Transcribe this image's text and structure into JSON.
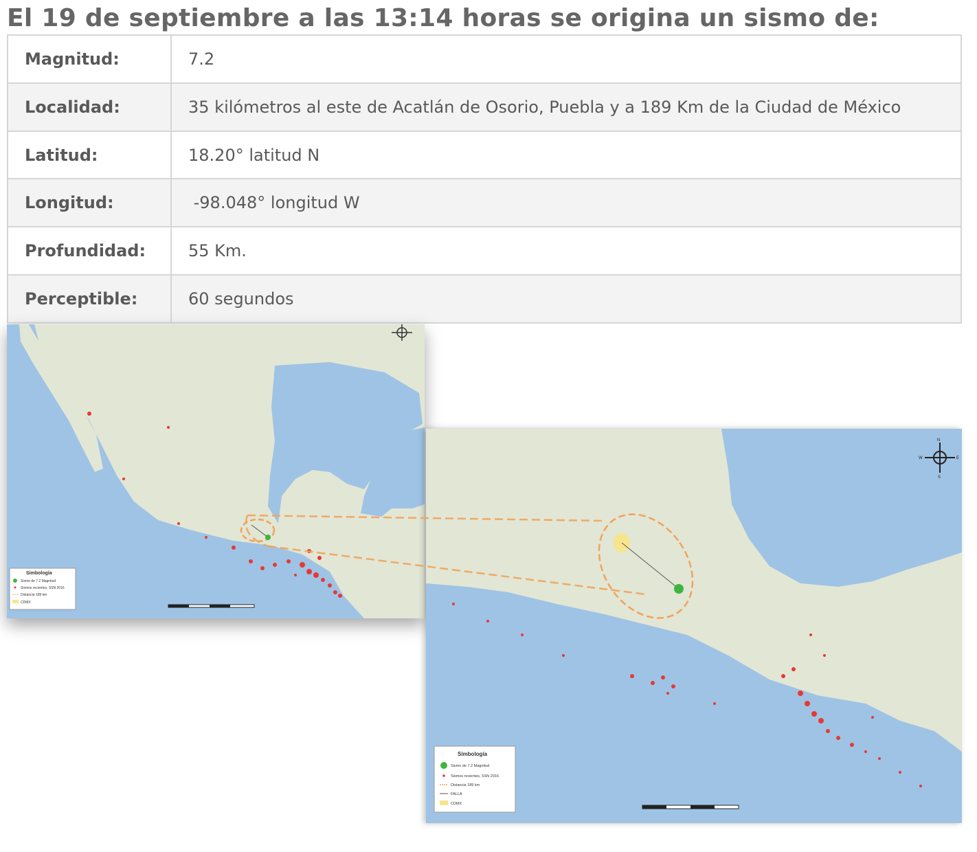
{
  "heading": "El 19 de septiembre a las 13:14 horas se origina un sismo de:",
  "rows": [
    {
      "label": "Magnitud:",
      "value": "7.2"
    },
    {
      "label": "Localidad:",
      "value": "35 kilómetros al este de Acatlán de Osorio, Puebla y a 189 Km de la Ciudad de México"
    },
    {
      "label": "Latitud:",
      "value": "18.20° latitud N"
    },
    {
      "label": "Longitud:",
      "value": " -98.048° longitud W"
    },
    {
      "label": "Profundidad:",
      "value": "55 Km."
    },
    {
      "label": "Perceptible:",
      "value": "60 segundos"
    }
  ],
  "maps": {
    "legend_title": "Simbología",
    "legend_small": [
      "Sismo de 7.2 Magnitud",
      "Sismos recientes, SSN 2016",
      "Distancia 189 km",
      "CDMX"
    ],
    "legend_large": [
      "Sismo de 7.2 Magnitud",
      "Sismos recientes, SSN 2016",
      "Distancia 189 km",
      "FALLA",
      "CDMX"
    ],
    "compass": {
      "n": "N",
      "s": "S",
      "e": "E",
      "w": "W"
    },
    "colors": {
      "ocean": "#9fc3e4",
      "land": "#e2e6d5",
      "epicenter": "#3fb53f",
      "recent_quakes": "#e53935",
      "distance": "#f0a35a",
      "cdmx": "#f6e58d"
    }
  }
}
